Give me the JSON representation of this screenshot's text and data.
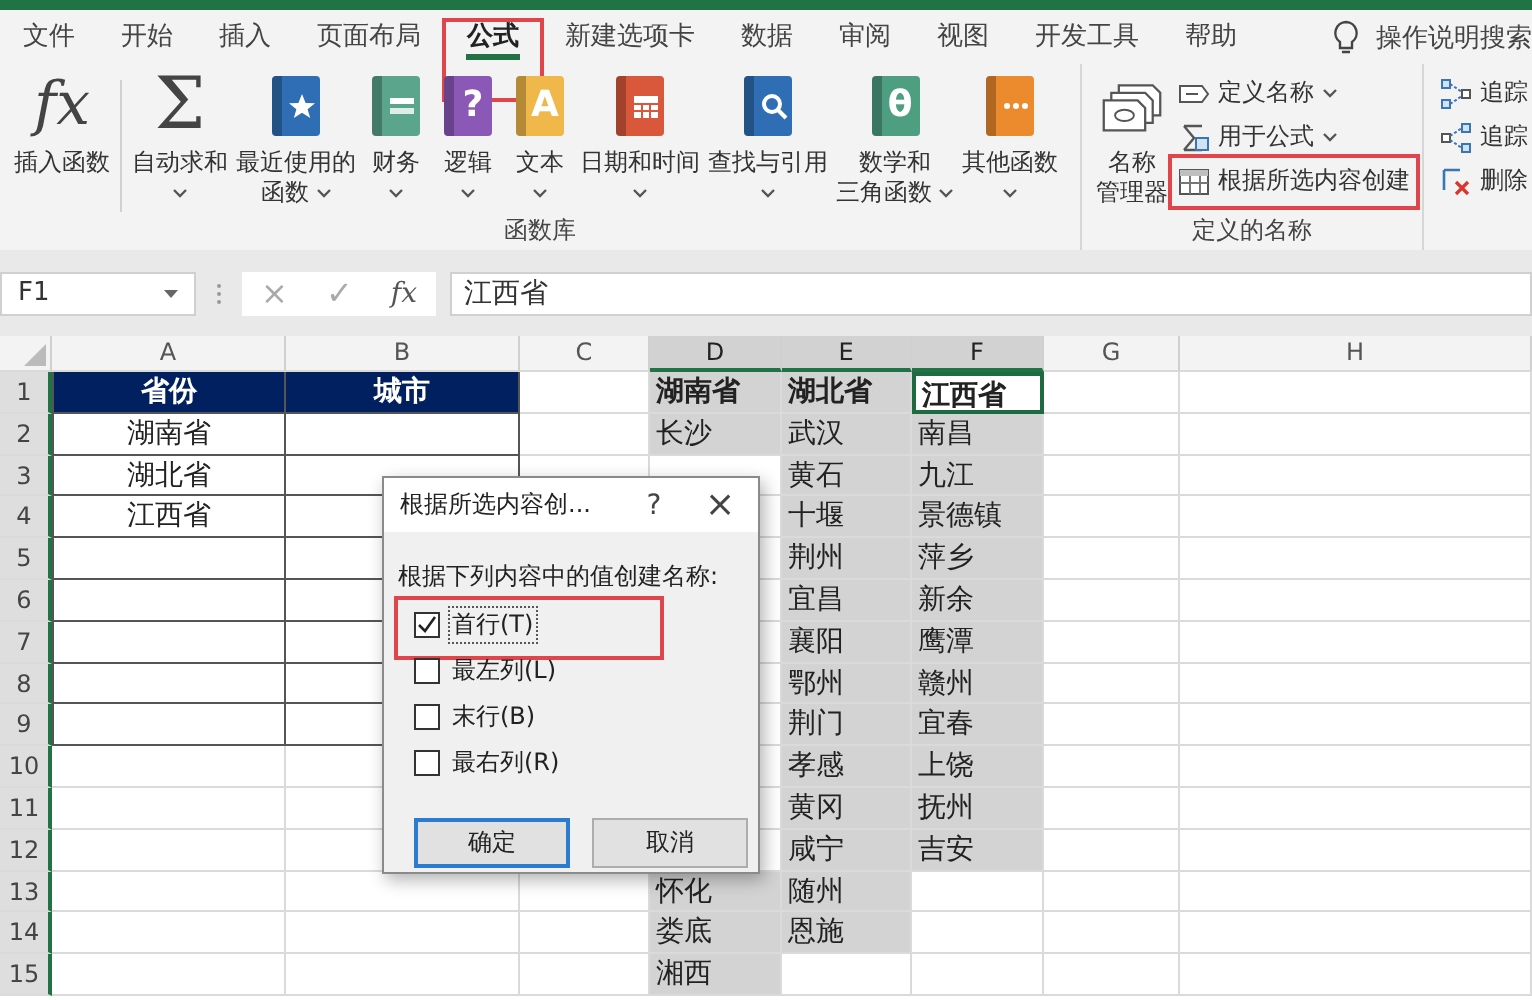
{
  "ribbon": {
    "tabs": [
      {
        "label": "文件",
        "selected": false,
        "highlighted": false
      },
      {
        "label": "开始",
        "selected": false,
        "highlighted": false
      },
      {
        "label": "插入",
        "selected": false,
        "highlighted": false
      },
      {
        "label": "页面布局",
        "selected": false,
        "highlighted": false
      },
      {
        "label": "公式",
        "selected": true,
        "highlighted": true
      },
      {
        "label": "新建选项卡",
        "selected": false,
        "highlighted": false
      },
      {
        "label": "数据",
        "selected": false,
        "highlighted": false
      },
      {
        "label": "审阅",
        "selected": false,
        "highlighted": false
      },
      {
        "label": "视图",
        "selected": false,
        "highlighted": false
      },
      {
        "label": "开发工具",
        "selected": false,
        "highlighted": false
      },
      {
        "label": "帮助",
        "selected": false,
        "highlighted": false
      }
    ],
    "tell_me": "操作说明搜索",
    "groups": [
      {
        "label": "函数库",
        "large_buttons": [
          {
            "lines": [
              "插入函数"
            ],
            "dropdown": false,
            "divider_after": true,
            "icon": {
              "kind": "glyph",
              "glyph": "fx"
            }
          },
          {
            "lines": [
              "自动求和"
            ],
            "dropdown": true,
            "divider_after": false,
            "icon": {
              "kind": "glyph",
              "glyph": "Σ"
            }
          },
          {
            "lines": [
              "最近使用的",
              "函数"
            ],
            "dropdown": true,
            "divider_after": false,
            "icon": {
              "kind": "book",
              "color": "#2f6eb5"
            }
          },
          {
            "lines": [
              "财务"
            ],
            "dropdown": true,
            "divider_after": false,
            "icon": {
              "kind": "book",
              "color": "#5aa58b"
            }
          },
          {
            "lines": [
              "逻辑"
            ],
            "dropdown": true,
            "divider_after": false,
            "icon": {
              "kind": "book",
              "color": "#8b58b8",
              "glyph": "?"
            }
          },
          {
            "lines": [
              "文本"
            ],
            "dropdown": true,
            "divider_after": false,
            "icon": {
              "kind": "book",
              "color": "#f0b84a",
              "glyph": "A"
            }
          },
          {
            "lines": [
              "日期和时间"
            ],
            "dropdown": true,
            "divider_after": false,
            "icon": {
              "kind": "book",
              "color": "#d9573b"
            }
          },
          {
            "lines": [
              "查找与引用"
            ],
            "dropdown": true,
            "divider_after": false,
            "icon": {
              "kind": "book",
              "color": "#2f6eb5"
            }
          },
          {
            "lines": [
              "数学和",
              "三角函数"
            ],
            "dropdown": true,
            "divider_after": false,
            "icon": {
              "kind": "book",
              "color": "#4e9e82",
              "glyph": "θ"
            }
          },
          {
            "lines": [
              "其他函数"
            ],
            "dropdown": true,
            "divider_after": false,
            "icon": {
              "kind": "book",
              "color": "#ec8a2e"
            }
          }
        ]
      },
      {
        "label": "定义的名称",
        "large_buttons": [
          {
            "lines": [
              "名称",
              "管理器"
            ],
            "dropdown": false,
            "divider_after": false,
            "icon": {
              "kind": "tags"
            }
          }
        ],
        "small_buttons": [
          {
            "label": "定义名称",
            "dropdown": true,
            "highlighted": false
          },
          {
            "label": "用于公式",
            "dropdown": true,
            "highlighted": false
          },
          {
            "label": "根据所选内容创建",
            "dropdown": false,
            "highlighted": true
          }
        ]
      },
      {
        "small_buttons": [
          {
            "label": "追踪",
            "dropdown": false,
            "highlighted": false
          },
          {
            "label": "追踪",
            "dropdown": false,
            "highlighted": false
          },
          {
            "label": "删除",
            "dropdown": false,
            "highlighted": false
          }
        ]
      }
    ]
  },
  "formula_bar": {
    "name_box": "F1",
    "cancel": "×",
    "enter": "✓",
    "function": "fx",
    "value": "江西省"
  },
  "sheet": {
    "columns": [
      {
        "label": "A",
        "selected": false
      },
      {
        "label": "B",
        "selected": false
      },
      {
        "label": "C",
        "selected": false
      },
      {
        "label": "D",
        "selected": true
      },
      {
        "label": "E",
        "selected": true
      },
      {
        "label": "F",
        "selected": true
      },
      {
        "label": "G",
        "selected": false
      },
      {
        "label": "H",
        "selected": false
      }
    ],
    "rows": [
      {
        "label": "1",
        "selected": true,
        "kind": "table_header",
        "cells": {
          "A": "省份",
          "B": "城市",
          "D": "湖南省",
          "E": "湖北省",
          "F": {
            "text": "江西省",
            "active": true
          }
        }
      },
      {
        "label": "2",
        "selected": true,
        "kind": "table_row",
        "cells": {
          "A": "湖南省",
          "D": "长沙",
          "E": "武汉",
          "F": "南昌"
        }
      },
      {
        "label": "3",
        "selected": true,
        "kind": "table_row",
        "cells": {
          "A": "湖北省",
          "E": "黄石",
          "F": "九江"
        }
      },
      {
        "label": "4",
        "selected": true,
        "kind": "table_row",
        "cells": {
          "A": "江西省",
          "E": "十堰",
          "F": "景德镇"
        }
      },
      {
        "label": "5",
        "selected": true,
        "kind": "table_row",
        "cells": {
          "E": "荆州",
          "F": "萍乡"
        }
      },
      {
        "label": "6",
        "selected": true,
        "kind": "table_row",
        "cells": {
          "E": "宜昌",
          "F": "新余"
        }
      },
      {
        "label": "7",
        "selected": true,
        "kind": "table_row",
        "cells": {
          "E": "襄阳",
          "F": "鹰潭"
        }
      },
      {
        "label": "8",
        "selected": true,
        "kind": "table_row",
        "cells": {
          "E": "鄂州",
          "F": "赣州"
        }
      },
      {
        "label": "9",
        "selected": true,
        "kind": "table_row",
        "cells": {
          "E": "荆门",
          "F": "宜春"
        }
      },
      {
        "label": "10",
        "selected": true,
        "kind": "plain",
        "cells": {
          "E": "孝感",
          "F": "上饶"
        }
      },
      {
        "label": "11",
        "selected": true,
        "kind": "plain",
        "cells": {
          "E": "黄冈",
          "F": "抚州"
        }
      },
      {
        "label": "12",
        "selected": true,
        "kind": "plain",
        "cells": {
          "E": "咸宁",
          "F": "吉安"
        }
      },
      {
        "label": "13",
        "selected": true,
        "kind": "plain",
        "cells": {
          "D": "怀化",
          "E": "随州"
        }
      },
      {
        "label": "14",
        "selected": true,
        "kind": "plain",
        "cells": {
          "D": "娄底",
          "E": "恩施"
        }
      },
      {
        "label": "15",
        "selected": true,
        "kind": "plain",
        "cells": {
          "D": "湘西"
        }
      }
    ]
  },
  "dialog": {
    "title": "根据所选内容创...",
    "help": "?",
    "close": "×",
    "prompt": "根据下列内容中的值创建名称:",
    "options": [
      {
        "label": "首行(T)",
        "checked": true,
        "focused": true,
        "highlighted": true
      },
      {
        "label": "最左列(L)",
        "checked": false,
        "focused": false,
        "highlighted": false
      },
      {
        "label": "末行(B)",
        "checked": false,
        "focused": false,
        "highlighted": false
      },
      {
        "label": "最右列(R)",
        "checked": false,
        "focused": false,
        "highlighted": false
      }
    ],
    "buttons": [
      {
        "label": "确定",
        "default": true
      },
      {
        "label": "取消",
        "default": false
      }
    ]
  }
}
